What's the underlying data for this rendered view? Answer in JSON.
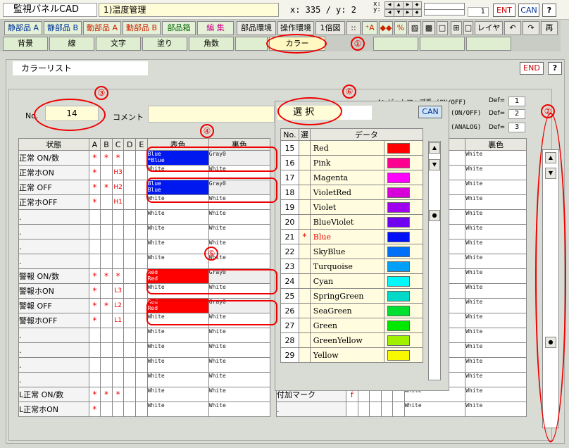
{
  "header": {
    "app_title": "監視パネルCAD",
    "page_name": "1)温度管理",
    "coords": "x: 335 / y:  2",
    "xy_label": "x:\ny:",
    "counter": "1",
    "ent": "ENT",
    "can": "CAN",
    "help": "?"
  },
  "toolbar1": {
    "items": [
      "静部品 A",
      "静部品 B",
      "動部品 A",
      "動部品 B",
      "部品箱",
      "編 集",
      "部品環境",
      "操作環境",
      "1倍図",
      "::",
      "⁺A",
      "◆◆",
      "%",
      "▨",
      "▩",
      "□",
      "⊞",
      "□",
      "レイヤ",
      "↶",
      "↷",
      "再"
    ]
  },
  "toolbar2": {
    "items": [
      "背景",
      "線",
      "文字",
      "塗り",
      "角数",
      "",
      "カラー",
      "",
      "",
      ""
    ]
  },
  "panel": {
    "title": "カラーリスト",
    "end_label": "END",
    "help": "?"
  },
  "form": {
    "no_label": "No.",
    "no_value": "14",
    "comment_label": "コメント",
    "comment_value": ""
  },
  "legend": {
    "line_a": "A：ビットマップ番 (ON/OFF)",
    "line_b": "(ON/OFF)",
    "line_c": "(ANALOG)",
    "def_label": "Def=",
    "defs": [
      "1",
      "2",
      "3"
    ]
  },
  "left_table": {
    "headers": [
      "状態",
      "A",
      "B",
      "C",
      "D",
      "E",
      "表色",
      "裏色"
    ],
    "rows": [
      {
        "state": "正常 ON/数",
        "a": "*",
        "b": "*",
        "c": "*",
        "d": "",
        "e": "",
        "front": [
          "Blue",
          "*Blue"
        ],
        "back": "Gray0",
        "style": "blue"
      },
      {
        "state": "正常ホON",
        "a": "*",
        "b": "",
        "c": "H3",
        "d": "",
        "e": "",
        "front": [
          "White"
        ],
        "back": "White",
        "style": ""
      },
      {
        "state": "正常 OFF",
        "a": "*",
        "b": "*",
        "c": "H2",
        "d": "",
        "e": "",
        "front": [
          "Blue",
          "Blue"
        ],
        "back": "Gray0",
        "style": "blue"
      },
      {
        "state": "正常ホOFF",
        "a": "*",
        "b": "",
        "c": "H1",
        "d": "",
        "e": "",
        "front": [
          "White"
        ],
        "back": "White",
        "style": ""
      },
      {
        "state": ".",
        "a": "",
        "b": "",
        "c": "",
        "d": "",
        "e": "",
        "front": [
          "White"
        ],
        "back": "White",
        "style": ""
      },
      {
        "state": ".",
        "a": "",
        "b": "",
        "c": "",
        "d": "",
        "e": "",
        "front": [
          "White"
        ],
        "back": "White",
        "style": ""
      },
      {
        "state": ".",
        "a": "",
        "b": "",
        "c": "",
        "d": "",
        "e": "",
        "front": [
          "White"
        ],
        "back": "White",
        "style": ""
      },
      {
        "state": ".",
        "a": "",
        "b": "",
        "c": "",
        "d": "",
        "e": "",
        "front": [
          "White"
        ],
        "back": "White",
        "style": ""
      },
      {
        "state": "警報 ON/数",
        "a": "*",
        "b": "*",
        "c": "*",
        "d": "",
        "e": "",
        "front": [
          "Red",
          "Red"
        ],
        "back": "Gray0",
        "style": "red"
      },
      {
        "state": "警報ホON",
        "a": "*",
        "b": "",
        "c": "L3",
        "d": "",
        "e": "",
        "front": [
          "White"
        ],
        "back": "White",
        "style": ""
      },
      {
        "state": "警報 OFF",
        "a": "*",
        "b": "*",
        "c": "L2",
        "d": "",
        "e": "",
        "front": [
          "Red",
          "Red"
        ],
        "back": "Gray0",
        "style": "red"
      },
      {
        "state": "警報ホOFF",
        "a": "*",
        "b": "",
        "c": "L1",
        "d": "",
        "e": "",
        "front": [
          "White"
        ],
        "back": "White",
        "style": ""
      },
      {
        "state": ".",
        "a": "",
        "b": "",
        "c": "",
        "d": "",
        "e": "",
        "front": [
          "White"
        ],
        "back": "White",
        "style": ""
      },
      {
        "state": ".",
        "a": "",
        "b": "",
        "c": "",
        "d": "",
        "e": "",
        "front": [
          "White"
        ],
        "back": "White",
        "style": ""
      },
      {
        "state": ".",
        "a": "",
        "b": "",
        "c": "",
        "d": "",
        "e": "",
        "front": [
          "White"
        ],
        "back": "White",
        "style": ""
      },
      {
        "state": ".",
        "a": "",
        "b": "",
        "c": "",
        "d": "",
        "e": "",
        "front": [
          "White"
        ],
        "back": "White",
        "style": ""
      },
      {
        "state": "L正常 ON/数",
        "a": "*",
        "b": "*",
        "c": "*",
        "d": "",
        "e": "",
        "front": [
          "White"
        ],
        "back": "White",
        "style": ""
      },
      {
        "state": "L正常ホON",
        "a": "*",
        "b": "",
        "c": "",
        "d": "",
        "e": "",
        "front": [
          "White"
        ],
        "back": "White",
        "style": ""
      }
    ]
  },
  "right_table": {
    "header": "裏色",
    "rows": [
      "White",
      "White",
      "White",
      "White",
      "White",
      "White",
      "White",
      "White",
      "White",
      "White",
      "White",
      "White",
      "White",
      "White",
      "White",
      "White"
    ],
    "bottom_rows": [
      {
        "state": "付加マーク",
        "mark": "f",
        "front": "White",
        "back": "White"
      },
      {
        "state": ".",
        "mark": "",
        "front": "White",
        "back": "White"
      }
    ]
  },
  "popup": {
    "title": "選 択",
    "can": "CAN",
    "headers": [
      "No.",
      "選",
      "データ"
    ],
    "rows": [
      {
        "no": "15",
        "sel": "",
        "name": "Red",
        "color": "#ff0000"
      },
      {
        "no": "16",
        "sel": "",
        "name": "Pink",
        "color": "#ff0090"
      },
      {
        "no": "17",
        "sel": "",
        "name": "Magenta",
        "color": "#ff00ff"
      },
      {
        "no": "18",
        "sel": "",
        "name": "VioletRed",
        "color": "#d800d8"
      },
      {
        "no": "19",
        "sel": "",
        "name": "Violet",
        "color": "#a000f0"
      },
      {
        "no": "20",
        "sel": "",
        "name": "BlueViolet",
        "color": "#7000f0"
      },
      {
        "no": "21",
        "sel": "*",
        "name": "Blue",
        "color": "#0010f8"
      },
      {
        "no": "22",
        "sel": "",
        "name": "SkyBlue",
        "color": "#0070f8"
      },
      {
        "no": "23",
        "sel": "",
        "name": "Turquoise",
        "color": "#00a0f8"
      },
      {
        "no": "24",
        "sel": "",
        "name": "Cyan",
        "color": "#00f8f8"
      },
      {
        "no": "25",
        "sel": "",
        "name": "SpringGreen",
        "color": "#00d8c8"
      },
      {
        "no": "26",
        "sel": "",
        "name": "SeaGreen",
        "color": "#00e030"
      },
      {
        "no": "27",
        "sel": "",
        "name": "Green",
        "color": "#00e800"
      },
      {
        "no": "28",
        "sel": "",
        "name": "GreenYellow",
        "color": "#a0f000"
      },
      {
        "no": "29",
        "sel": "",
        "name": "Yellow",
        "color": "#f8f800"
      }
    ]
  },
  "annotations": [
    "①",
    "②",
    "③",
    "④",
    "⑤",
    "⑥"
  ]
}
